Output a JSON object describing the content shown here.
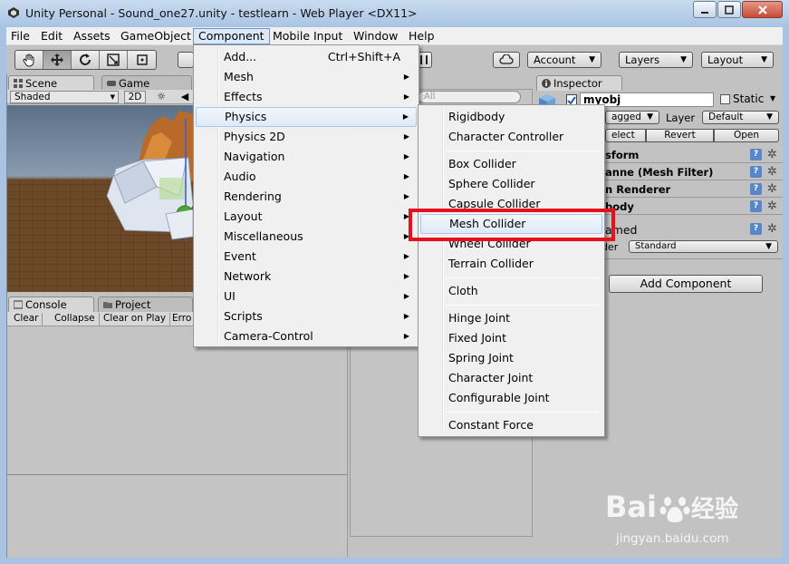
{
  "window": {
    "title": "Unity Personal - Sound_one27.unity - testlearn - Web Player <DX11>",
    "controls": [
      "minimize",
      "maximize",
      "close"
    ]
  },
  "menubar": {
    "items": [
      "File",
      "Edit",
      "Assets",
      "GameObject",
      "Component",
      "Mobile Input",
      "Window",
      "Help"
    ],
    "open_item": "Component"
  },
  "toolbar": {
    "account_label": "Account",
    "layers_label": "Layers",
    "layout_label": "Layout"
  },
  "scene": {
    "tab_scene": "Scene",
    "tab_game": "Game",
    "shading": "Shaded",
    "mode_2d": "2D"
  },
  "console": {
    "tab_console": "Console",
    "tab_project": "Project",
    "buttons": [
      "Clear",
      "Collapse",
      "Clear on Play",
      "Erro"
    ]
  },
  "hierarchy": {
    "search_placeholder": "All"
  },
  "inspector": {
    "tab_label": "Inspector",
    "object_name": "myobj",
    "static_label": "Static",
    "tag_value": "agged",
    "layer_label": "Layer",
    "layer_value": "Default",
    "prefab_select": "elect",
    "prefab_revert": "Revert",
    "prefab_open": "Open",
    "components": [
      "sform",
      "anne (Mesh Filter)",
      "n Renderer",
      "body"
    ],
    "material_name": "amed",
    "shader_label": "der",
    "shader_value": "Standard",
    "add_component": "Add Component"
  },
  "component_menu": {
    "items": [
      {
        "label": "Add...",
        "shortcut": "Ctrl+Shift+A"
      },
      {
        "label": "Mesh",
        "submenu": true
      },
      {
        "label": "Effects",
        "submenu": true
      },
      {
        "label": "Physics",
        "submenu": true
      },
      {
        "label": "Physics 2D",
        "submenu": true
      },
      {
        "label": "Navigation",
        "submenu": true
      },
      {
        "label": "Audio",
        "submenu": true
      },
      {
        "label": "Rendering",
        "submenu": true
      },
      {
        "label": "Layout",
        "submenu": true
      },
      {
        "label": "Miscellaneous",
        "submenu": true
      },
      {
        "label": "Event",
        "submenu": true
      },
      {
        "label": "Network",
        "submenu": true
      },
      {
        "label": "UI",
        "submenu": true
      },
      {
        "label": "Scripts",
        "submenu": true
      },
      {
        "label": "Camera-Control",
        "submenu": true
      }
    ],
    "hovered": "Physics"
  },
  "physics_menu": {
    "groups": [
      [
        "Rigidbody",
        "Character Controller"
      ],
      [
        "Box Collider",
        "Sphere Collider",
        "Capsule Collider",
        "Mesh Collider",
        "Wheel Collider",
        "Terrain Collider"
      ],
      [
        "Cloth"
      ],
      [
        "Hinge Joint",
        "Fixed Joint",
        "Spring Joint",
        "Character Joint",
        "Configurable Joint"
      ],
      [
        "Constant Force"
      ]
    ],
    "hovered": "Mesh Collider",
    "highlight_color": "#e8101c"
  },
  "watermark": {
    "brand": "Bai 经验",
    "url": "jingyan.baidu.com"
  }
}
